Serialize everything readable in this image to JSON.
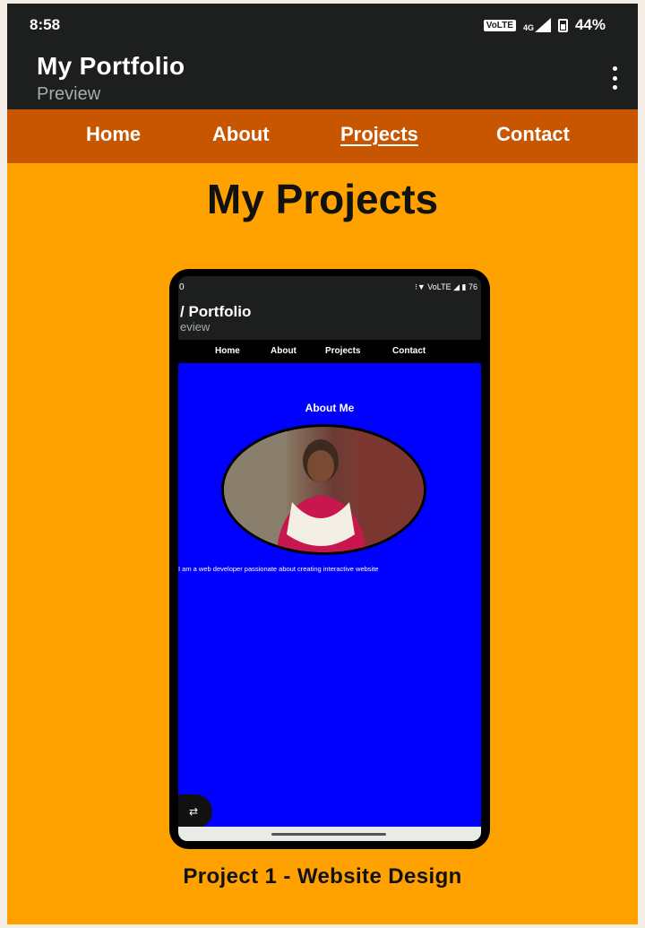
{
  "status_bar": {
    "time": "8:58",
    "volte": "VoLTE",
    "network": "4G",
    "battery": "44%"
  },
  "app_bar": {
    "title": "My Portfolio",
    "subtitle": "Preview",
    "menu_icon": "more-vert-icon"
  },
  "nav": {
    "items": [
      {
        "label": "Home",
        "active": false
      },
      {
        "label": "About",
        "active": false
      },
      {
        "label": "Projects",
        "active": true
      },
      {
        "label": "Contact",
        "active": false
      }
    ]
  },
  "page": {
    "title": "My Projects"
  },
  "project_preview": {
    "status_time": "0",
    "status_right": "⁝▼ VoLTE ◢ ▮ 76",
    "app_title": "/ Portfolio",
    "app_subtitle": "eview",
    "nav": [
      "Home",
      "About",
      "Projects",
      "Contact"
    ],
    "about_heading": "About Me",
    "bio": "I am a web developer passionate about creating interactive website",
    "fab_icon": "rotate-icon"
  },
  "project": {
    "caption": "Project 1 - Website Design"
  },
  "colors": {
    "page_bg": "#ffa200",
    "nav_bg": "#c85500",
    "app_bar_bg": "#1c1f1d",
    "preview_bg": "#0000ff"
  }
}
